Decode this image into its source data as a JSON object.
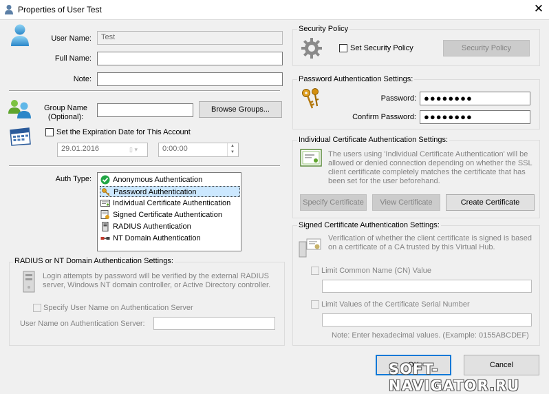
{
  "window": {
    "title": "Properties of User Test"
  },
  "user": {
    "username_label": "User Name:",
    "username_value": "Test",
    "fullname_label": "Full Name:",
    "fullname_value": "",
    "note_label": "Note:",
    "note_value": ""
  },
  "group": {
    "label_line1": "Group Name",
    "label_line2": "(Optional):",
    "value": "",
    "browse_button": "Browse Groups..."
  },
  "expiration": {
    "checkbox_label": "Set the Expiration Date for This Account",
    "checked": false,
    "date_value": "29.01.2016",
    "time_value": "0:00:00"
  },
  "auth": {
    "label": "Auth Type:",
    "types": [
      {
        "label": "Anonymous Authentication",
        "icon": "check-circle-icon"
      },
      {
        "label": "Password Authentication",
        "icon": "keys-icon",
        "selected": true
      },
      {
        "label": "Individual Certificate Authentication",
        "icon": "certificate-icon"
      },
      {
        "label": "Signed Certificate Authentication",
        "icon": "signed-certificate-icon"
      },
      {
        "label": "RADIUS Authentication",
        "icon": "server-icon"
      },
      {
        "label": "NT Domain Authentication",
        "icon": "network-cable-icon"
      }
    ]
  },
  "radius": {
    "group_title": "RADIUS or NT Domain Authentication Settings:",
    "description": "Login attempts by password will be verified by the external RADIUS server, Windows NT domain controller, or Active Directory controller.",
    "specify_checkbox": "Specify User Name on Authentication Server",
    "server_username_label": "User Name on Authentication Server:",
    "server_username_value": ""
  },
  "security_policy": {
    "group_title": "Security Policy",
    "checkbox_label": "Set Security Policy",
    "button": "Security Policy"
  },
  "password": {
    "group_title": "Password Authentication Settings:",
    "password_label": "Password:",
    "password_value": "●●●●●●●●",
    "confirm_label": "Confirm Password:",
    "confirm_value": "●●●●●●●●"
  },
  "individual_cert": {
    "group_title": "Individual Certificate Authentication Settings:",
    "description": "The users using 'Individual Certificate Authentication' will be allowed or denied connection depending on whether the SSL client certificate completely matches the certificate that has been set for the user beforehand.",
    "specify_button": "Specify Certificate",
    "view_button": "View Certificate",
    "create_button": "Create Certificate"
  },
  "signed_cert": {
    "group_title": "Signed Certificate Authentication Settings:",
    "description": "Verification of whether the client certificate is signed is based on a certificate of a CA trusted by this Virtual Hub.",
    "limit_cn_label": "Limit Common Name (CN) Value",
    "cn_value": "",
    "limit_serial_label": "Limit Values of the Certificate Serial Number",
    "serial_value": "",
    "note": "Note: Enter hexadecimal values. (Example: 0155ABCDEF)"
  },
  "footer": {
    "ok_button": "OK",
    "cancel_button": "Cancel"
  },
  "watermark": "SOFT-NAVIGATOR.RU",
  "colors": {
    "accent": "#0078d7",
    "selection": "#cce8ff"
  }
}
